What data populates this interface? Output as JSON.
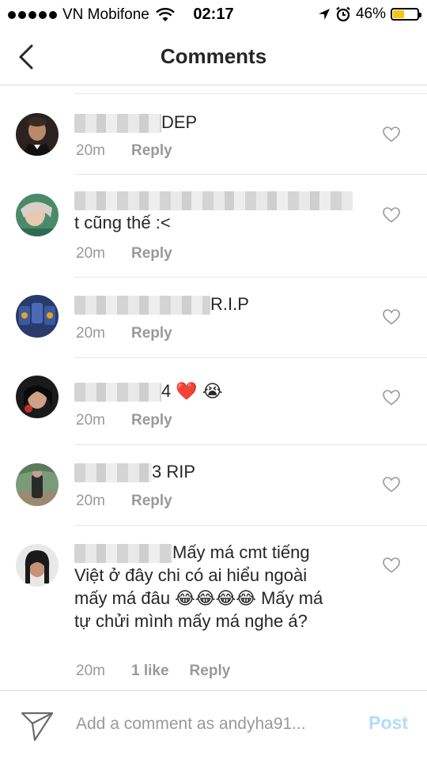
{
  "status_bar": {
    "carrier": "VN Mobifone",
    "time": "02:17",
    "battery": "46%",
    "battery_level": 0.46
  },
  "nav": {
    "title": "Comments"
  },
  "comments": [
    {
      "text": "DEP",
      "time": "20m",
      "reply": "Reply"
    },
    {
      "text": "t cũng thế :<",
      "time": "20m",
      "reply": "Reply"
    },
    {
      "text": "R.I.P",
      "time": "20m",
      "reply": "Reply"
    },
    {
      "text": "4 ❤️ 😭",
      "time": "20m",
      "reply": "Reply"
    },
    {
      "text": "3 RIP",
      "time": "20m",
      "reply": "Reply"
    },
    {
      "text": "Mấy má cmt tiếng Việt ở đây chi có ai hiểu ngoài mấy má đâu 😂😂😂😂  Mấy má tự chửi mình mấy má nghe á?",
      "time": "20m",
      "likes": "1 like",
      "reply": "Reply"
    }
  ],
  "composer": {
    "placeholder": "Add a comment as andyha91...",
    "post_label": "Post"
  },
  "colors": {
    "post_disabled": "#b3dbff",
    "meta_text": "#999999",
    "separator": "#dbdbdb"
  }
}
